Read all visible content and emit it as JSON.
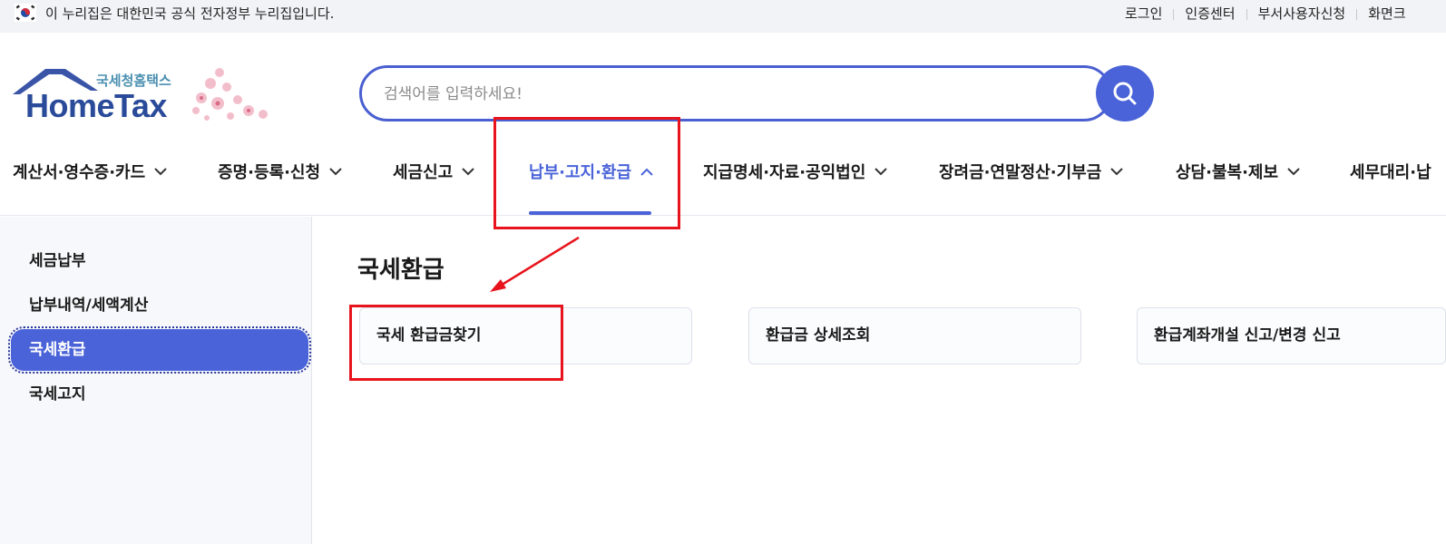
{
  "gov_bar": {
    "notice": "이 누리집은 대한민국 공식 전자정부 누리집입니다.",
    "links": [
      "로그인",
      "인증센터",
      "부서사용자신청",
      "화면크"
    ]
  },
  "logo": {
    "subtitle": "국세청홈택스",
    "title": "HomeTax"
  },
  "search": {
    "placeholder": "검색어를 입력하세요!",
    "button_icon": "search-icon"
  },
  "nav": {
    "items": [
      "계산서·영수증·카드",
      "증명·등록·신청",
      "세금신고",
      "납부·고지·환급",
      "지급명세·자료·공익법인",
      "장려금·연말정산·기부금",
      "상담·불복·제보",
      "세무대리·납"
    ],
    "active_index": 3
  },
  "sidebar": {
    "items": [
      "세금납부",
      "납부내역/세액계산",
      "국세환급",
      "국세고지"
    ],
    "active_index": 2
  },
  "content": {
    "title": "국세환급",
    "cards": [
      "국세 환급금찾기",
      "환급금 상세조회",
      "환급계좌개설 신고/변경 신고"
    ]
  },
  "colors": {
    "accent": "#4a63d8",
    "annotation": "#e8141d",
    "gov_bar_bg": "#f2f3f6"
  }
}
